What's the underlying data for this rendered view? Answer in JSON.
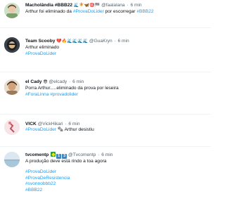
{
  "tweets": [
    {
      "name": "Macholândia #BBB22",
      "name_emojis": "🌊🧚🦋🎯🏁",
      "handle": "@faalalana",
      "time": "6 min",
      "text_parts": [
        "Arthur foi eliminado da ",
        "#ProvaDoLider",
        " por escorregar ",
        "#BBB22"
      ]
    },
    {
      "name": "Team Scooby",
      "name_emojis": "💔🔥🌊🌊🌊🌊",
      "handle": "@GuaKryn",
      "time": "6 min",
      "lines": [
        "Arthur eliminado",
        "#ProvaDoLider"
      ]
    },
    {
      "name": "el Cady",
      "name_emojis": "😎",
      "handle": "@elcady",
      "time": "6 min",
      "lines": [
        "Porra Arthur.....eliminado da prova por leseira",
        "#ForaLinna #provadolider"
      ]
    },
    {
      "name": "VICK",
      "handle": "@VickHikari",
      "time": "6 min",
      "text_parts": [
        "#ProvaDoLider",
        " 🗞 ",
        "Arthur desistiu"
      ]
    },
    {
      "name": "tvcomentp",
      "badge_num_1": "1",
      "badge_num_2": "3",
      "handle": "@Tvcomentp",
      "time": "6 min",
      "lines": [
        "A produção deve está rindo a toa agora",
        "",
        "#ProvaDoLider",
        "#ProvaDeResistencia",
        "#svonnobbb22",
        "#BBB22"
      ]
    }
  ],
  "separator": "·"
}
